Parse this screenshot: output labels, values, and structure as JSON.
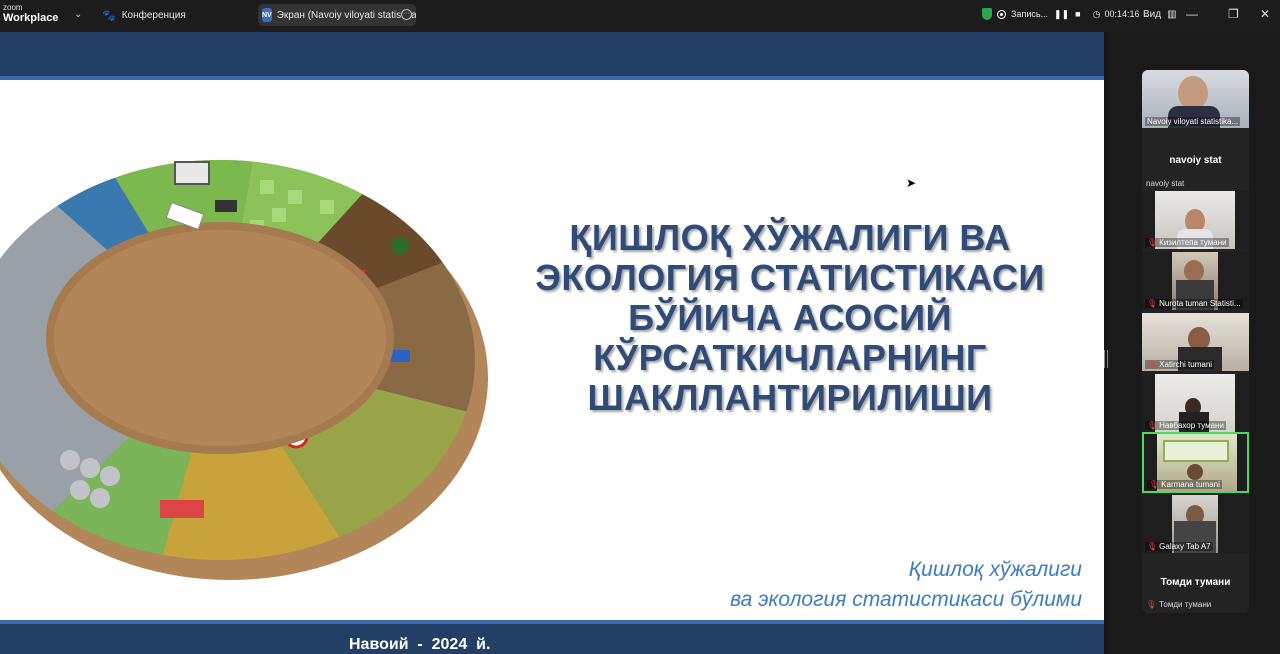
{
  "topbar": {
    "logo_line1": "zoom",
    "logo_line2": "Workplace",
    "conference_label": "Конференция",
    "screen_share_badge": "NV",
    "screen_share_label": "Экран (Navoiy viloyati  statistika",
    "recording_label": "Запись...",
    "timer": "00:14:16",
    "view_label": "Вид",
    "colors": {
      "shield": "#2ea44f",
      "accent": "#3d6fb5"
    }
  },
  "slide": {
    "title_lines": [
      "ҚИШЛОҚ ХЎЖАЛИГИ ВА",
      "ЭКОЛОГИЯ СТАТИСТИКАСИ",
      "БЎЙИЧА АСОСИЙ",
      "КЎРСАТКИЧЛАРНИНГ",
      "ШАКЛЛАНТИРИЛИШИ"
    ],
    "subtitle_lines": [
      "Қишлоқ хўжалиги",
      "ва экология статистикаси бўлими"
    ],
    "footer": "Навоий  -  2024  й.",
    "colors": {
      "band": "#243f66",
      "title": "#2f4b78",
      "subtitle": "#3b7cc4"
    }
  },
  "participants": {
    "host_name": "Navoiy viloyati  statistika...",
    "host_display": "navoiy stat",
    "host_small": "navoiy stat",
    "tiles": [
      {
        "name": "Кизилтепа тумани"
      },
      {
        "name": "Nurota tuman Statisti..."
      },
      {
        "name": "Xatirchi tumani"
      },
      {
        "name": "Навбахор тумани"
      },
      {
        "name": "Karmana tumani"
      },
      {
        "name": "Galaxy Tab A7"
      }
    ],
    "last_display": "Томди тумани",
    "last_small": "Томди тумани"
  }
}
